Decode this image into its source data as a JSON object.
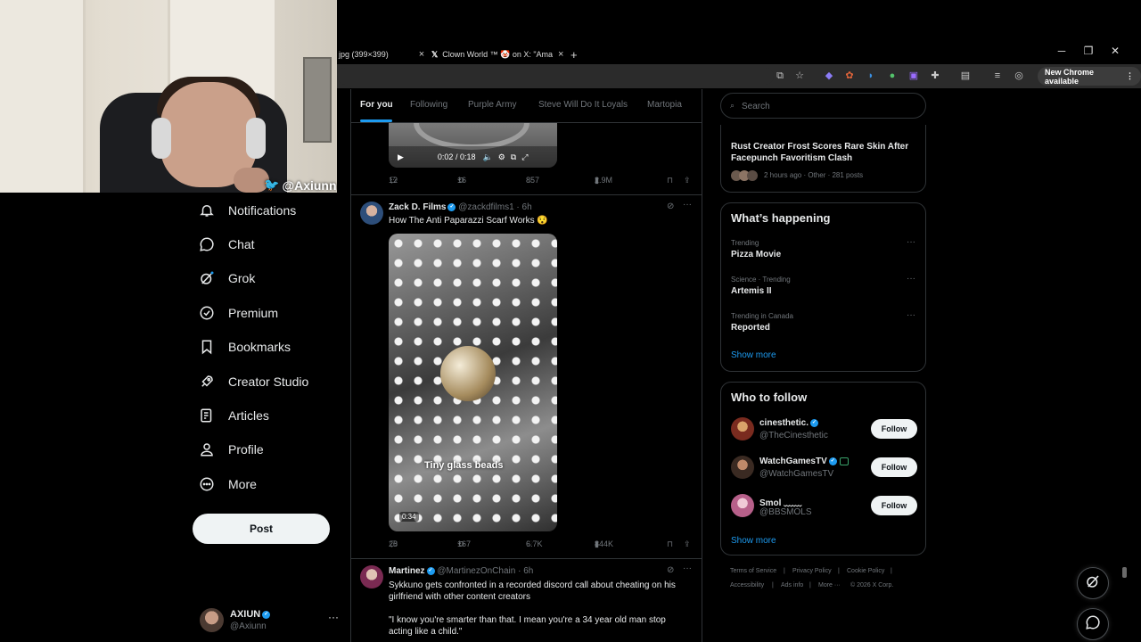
{
  "browser": {
    "tabs": [
      {
        "label": "jpg (399×399)",
        "close": "×"
      },
      {
        "label": "Clown World ™ 🤡 on X: \"Ama",
        "close": "×"
      }
    ],
    "new_tab": "+",
    "new_chrome_label": "New Chrome available",
    "window_controls": [
      "─",
      "❐",
      "✕"
    ]
  },
  "webcam": {
    "handle": "@Axiunn"
  },
  "nav": {
    "items": [
      {
        "label": "Notifications",
        "icon": "bell-icon"
      },
      {
        "label": "Chat",
        "icon": "chat-bubble-icon"
      },
      {
        "label": "Grok",
        "icon": "grok-icon"
      },
      {
        "label": "Premium",
        "icon": "verified-badge-icon"
      },
      {
        "label": "Bookmarks",
        "icon": "bookmark-icon"
      },
      {
        "label": "Creator Studio",
        "icon": "rocket-icon"
      },
      {
        "label": "Articles",
        "icon": "article-icon"
      },
      {
        "label": "Profile",
        "icon": "person-icon"
      },
      {
        "label": "More",
        "icon": "more-circle-icon"
      }
    ],
    "post_label": "Post",
    "account": {
      "name": "AXIUN",
      "handle": "@Axiunn",
      "more": "···"
    }
  },
  "feed": {
    "tabs": [
      "For you",
      "Following",
      "Purple Army",
      "Steve Will Do It Loyals",
      "Martopia"
    ],
    "active_tab": "For you",
    "first_post": {
      "video_time": "0:02 / 0:18",
      "replies": "12",
      "reposts": "16",
      "likes": "857",
      "views": "2.9M"
    },
    "posts": [
      {
        "name": "Zack D. Films",
        "handle": "@zackdfilms1 · 6h",
        "text": "How The Anti Paparazzi Scarf Works 😯",
        "video_caption": "Tiny glass beads",
        "video_duration": "0:34",
        "replies": "28",
        "reposts": "167",
        "likes": "6.7K",
        "views": "844K"
      },
      {
        "name": "Martinez",
        "handle": "@MartinezOnChain · 6h",
        "text": "Sykkuno gets confronted in a recorded discord call about cheating on his girlfriend with other content creators",
        "quote": "\"I know you're smarter than that. I mean you're a 34 year old man stop acting like a child.\""
      }
    ]
  },
  "sidebar": {
    "search_placeholder": "Search",
    "top_story": {
      "title": "Rust Creator Frost Scores Rare Skin After Facepunch Favoritism Clash",
      "meta": "2 hours ago · Other · 281 posts"
    },
    "whats_happening": {
      "title": "What’s happening",
      "trends": [
        {
          "meta": "Trending",
          "name": "Pizza Movie"
        },
        {
          "meta": "Science · Trending",
          "name": "Artemis II"
        },
        {
          "meta": "Trending in Canada",
          "name": "Reported"
        }
      ],
      "show_more": "Show more"
    },
    "who_to_follow": {
      "title": "Who to follow",
      "accounts": [
        {
          "name": "cinesthetic.",
          "handle": "@TheCinesthetic",
          "button": "Follow"
        },
        {
          "name": "WatchGamesTV",
          "handle": "@WatchGamesTV",
          "button": "Follow"
        },
        {
          "name": "Smol ﹏﹏",
          "handle": "@BBSMOLS",
          "button": "Follow"
        }
      ],
      "show_more": "Show more"
    },
    "footer": {
      "links": [
        "Terms of Service",
        "Privacy Policy",
        "Cookie Policy",
        "Accessibility",
        "Ads info",
        "More ···",
        "© 2026 X Corp."
      ],
      "separator": "|"
    }
  },
  "colors": {
    "accent": "#1d9bf0",
    "background": "#000000",
    "border": "#2f3336",
    "muted": "#71767b"
  }
}
